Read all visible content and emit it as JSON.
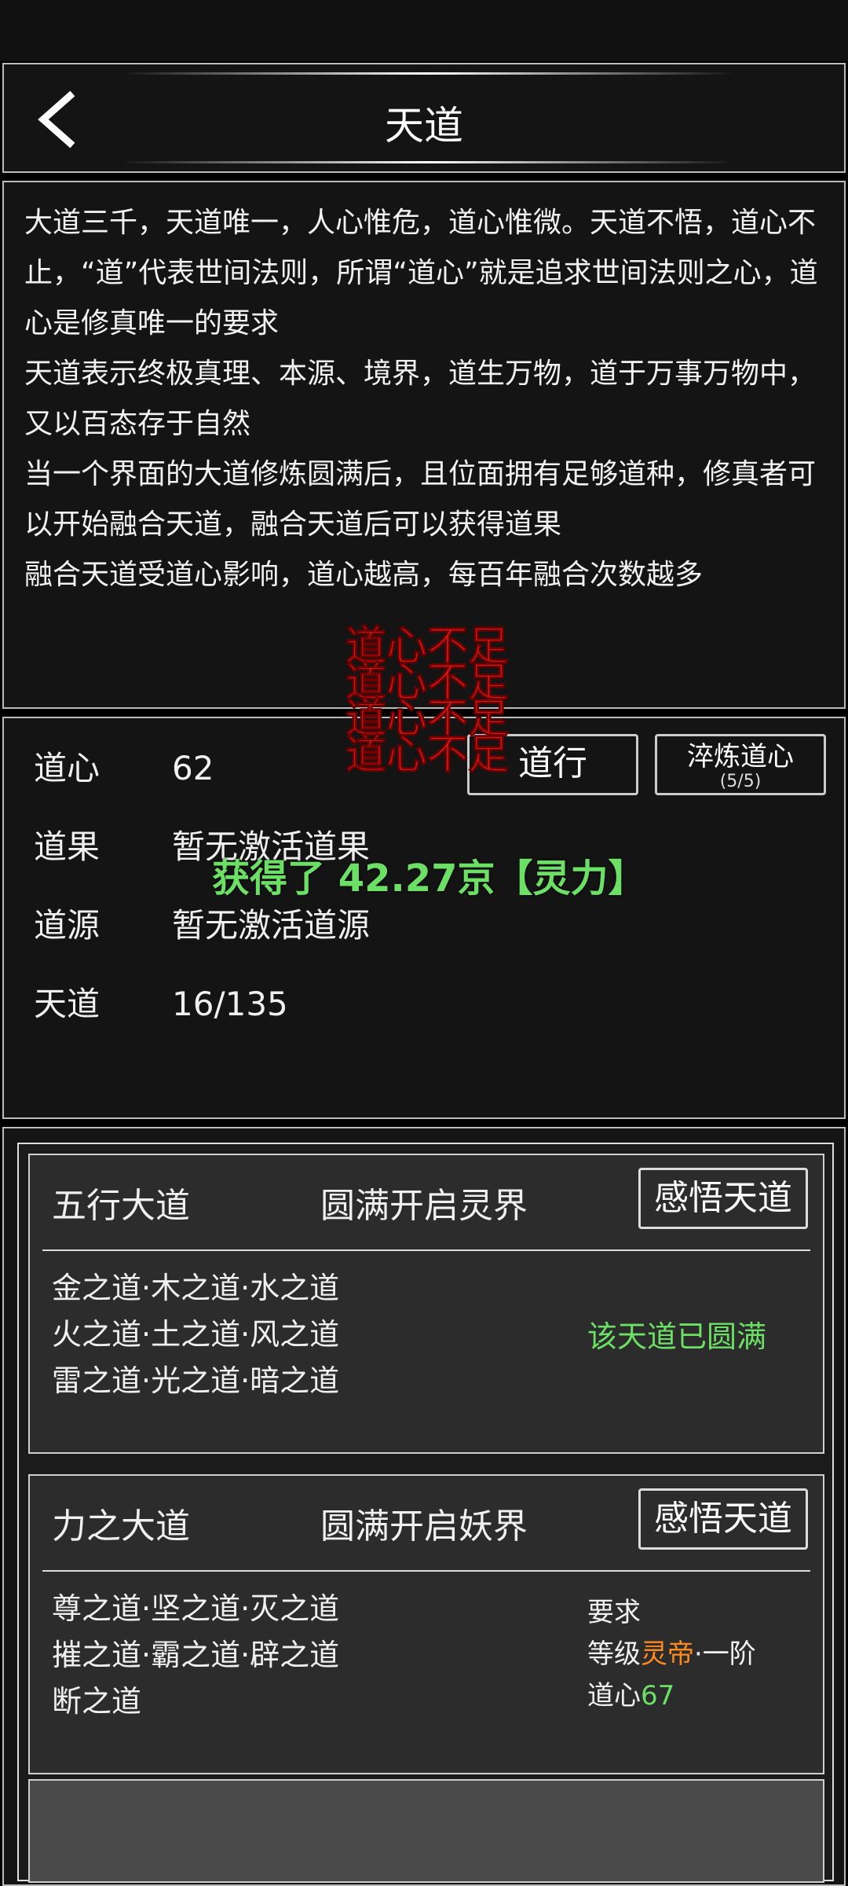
{
  "header": {
    "title": "天道"
  },
  "description": [
    "大道三千，天道唯一，人心惟危，道心惟微。天道不悟，道心不止，“道”代表世间法则，所谓“道心”就是追求世间法则之心，道心是修真唯一的要求",
    "天道表示终极真理、本源、境界，道生万物，道于万事万物中，又以百态存于自然",
    "当一个界面的大道修炼圆满后，且位面拥有足够道种，修真者可以开始融合天道，融合天道后可以获得道果",
    "融合天道受道心影响，道心越高，每百年融合次数越多"
  ],
  "stats": {
    "daoxin": {
      "label": "道心",
      "value": "62"
    },
    "daoguo": {
      "label": "道果",
      "value": "暂无激活道果"
    },
    "daoyuan": {
      "label": "道源",
      "value": "暂无激活道源"
    },
    "tiandao": {
      "label": "天道",
      "value": "16/135"
    }
  },
  "buttons": {
    "daoxing": "道行",
    "cuilian": "淬炼道心",
    "cuilian_count": "(5/5)"
  },
  "warnings": [
    "道心不足",
    "道心不足",
    "道心不足",
    "道心不足"
  ],
  "toast": "获得了 42.27京【灵力】",
  "cards": [
    {
      "name": "五行大道",
      "unlock": "圆满开启灵界",
      "action": "感悟天道",
      "ways": [
        "金之道·木之道·水之道",
        "火之道·土之道·风之道",
        "雷之道·光之道·暗之道"
      ],
      "status": "该天道已圆满"
    },
    {
      "name": "力之大道",
      "unlock": "圆满开启妖界",
      "action": "感悟天道",
      "ways": [
        "尊之道·坚之道·灭之道",
        "摧之道·霸之道·辟之道",
        "断之道"
      ],
      "requirement": {
        "title": "要求",
        "level_prefix": "等级",
        "level_name": "灵帝",
        "level_suffix": "·一阶",
        "daoxin_prefix": "道心",
        "daoxin_value": "67"
      }
    }
  ],
  "colors": {
    "warning": "#e81414",
    "toast": "#6ce064",
    "complete": "#6ce064",
    "level": "#ff8a1e"
  }
}
